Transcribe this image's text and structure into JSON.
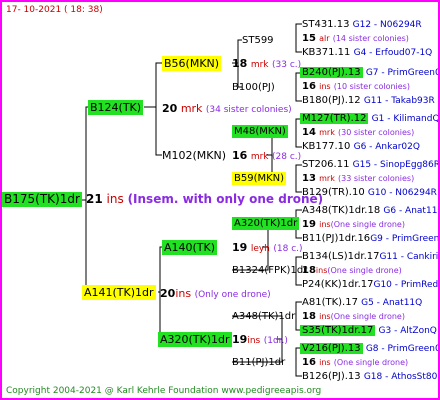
{
  "header": {
    "date": "17- 10-2021 ( 18: 38)"
  },
  "footer": {
    "copyright": "Copyright 2004-2021 @ Karl Kehrle Foundation",
    "site": "www.pedigreeapis.org"
  },
  "root": {
    "label": "B175(TK)1dr",
    "num": "21",
    "ins": "ins",
    "note": "(Insem. with only one drone)"
  },
  "g1": {
    "top": {
      "label": "B124(TK)",
      "num": "20",
      "type": "mrk",
      "note": "(34 sister colonies)"
    },
    "bottom": {
      "label": "A141(TK)1dr",
      "num": "20",
      "type": "ins",
      "note": "(Only one drone)"
    }
  },
  "g2": {
    "a": {
      "label": "B56(MKN)",
      "num": "18",
      "type": "mrk",
      "note": "(33 c.)"
    },
    "b": {
      "label": "M102(MKN)",
      "num": "16",
      "type": "mrk",
      "note": "(28 c.)"
    },
    "c": {
      "label": "A140(TK)",
      "num": "19",
      "type": "leyh",
      "note": "(18 c.)"
    },
    "d": {
      "label": "A320(TK)1dr",
      "num": "19",
      "type": "ins",
      "note": "(1dr.)"
    }
  },
  "g3": {
    "a": {
      "label": "ST599"
    },
    "b": {
      "label": "B100(PJ)"
    },
    "c": {
      "label": "M48(MKN)",
      "num": "14",
      "type": "mrk",
      "note": "(30 sister colonies)"
    },
    "d": {
      "label": "B59(MKN)",
      "num": "13",
      "type": "mrk",
      "note": "(33 sister colonies)"
    },
    "e": {
      "label": "A320(TK)1dr",
      "num": "19",
      "type": "ins",
      "note": "(One single drone)"
    },
    "f": {
      "label": "B1324(FPK)1dr",
      "num": "18",
      "type": "ins",
      "note": "(One single drone)"
    },
    "g": {
      "label": "A348(TK)1dr",
      "num": "18",
      "type": "ins",
      "note": "(One single drone)"
    },
    "h": {
      "label": "B11(PJ)1dr",
      "num": "16",
      "type": "ins",
      "note": "(One single drone)"
    }
  },
  "g4": [
    {
      "label": "ST431.13",
      "tag": "G12 - N06294R"
    },
    {
      "label": "15",
      "type": "alr",
      "note": "(14 sister colonies)"
    },
    {
      "label": "KB371.11",
      "tag": "G4 - Erfoud07-1Q"
    },
    {
      "label": "B240(PJ).13",
      "tag": "G7 - PrimGreen00"
    },
    {
      "label": "16",
      "type": "ins",
      "note": "(10 sister colonies)"
    },
    {
      "label": "B180(PJ).12",
      "tag": "G11 - Takab93R"
    },
    {
      "label": "M127(TR).12",
      "tag": "G1 - KilimandQ"
    },
    {
      "label": "KB177.10",
      "tag": "G6 - Ankar02Q"
    },
    {
      "label": "ST206.11",
      "tag": "G15 - SinopEgg86R"
    },
    {
      "label": "B129(TR).10",
      "tag": "G10 - N06294R"
    },
    {
      "label": "A348(TK)1dr.18",
      "tag": "G6 - Anat11Q"
    },
    {
      "label": "B11(PJ)1dr.16",
      "tag": "G9 - PrimGreen00"
    },
    {
      "label": "B134(LS)1dr.17",
      "tag": "G11 - Cankiri97Q"
    },
    {
      "label": "P24(KK)1dr.17",
      "tag": "G10 - PrimRed01"
    },
    {
      "label": "A81(TK).17",
      "tag": "G5 - Anat11Q"
    },
    {
      "label": "S35(TK)1dr.17",
      "tag": "G3 - AltZonQ"
    },
    {
      "label": "V216(PJ).13",
      "tag": "G8 - PrimGreen00"
    },
    {
      "label": "B126(PJ).13",
      "tag": "G18 - AthosSt80R"
    }
  ]
}
